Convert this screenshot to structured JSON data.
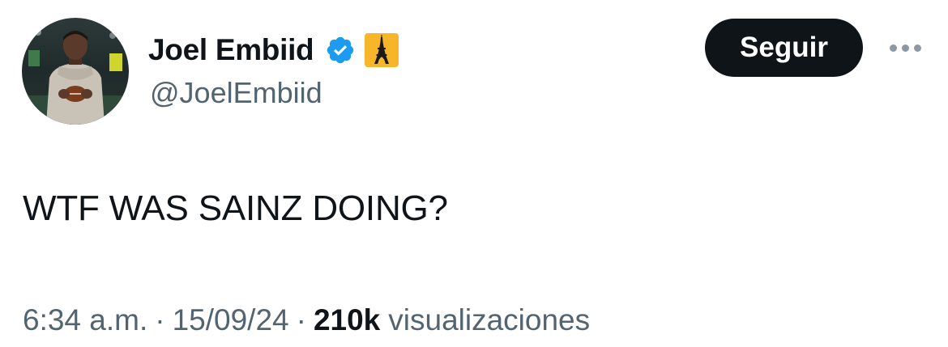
{
  "author": {
    "display_name": "Joel Embiid",
    "handle": "@JoelEmbiid",
    "verified_badge_icon": "verified-check-icon",
    "verified_color": "#1d9bf0",
    "affiliate_badge_icon": "eiffel-tower-icon",
    "affiliate_badge_color": "#f7b529",
    "avatar": "profile-photo"
  },
  "actions": {
    "follow_label": "Seguir",
    "more_icon": "more-horizontal-icon"
  },
  "tweet": {
    "text": "WTF WAS SAINZ DOING?"
  },
  "meta": {
    "time": "6:34 a.m.",
    "separator": "·",
    "date": "15/09/24",
    "views_count": "210k",
    "views_label": "visualizaciones"
  },
  "colors": {
    "text_primary": "#0f1419",
    "text_secondary": "#536471",
    "button_bg": "#0f1419",
    "button_text": "#ffffff"
  }
}
